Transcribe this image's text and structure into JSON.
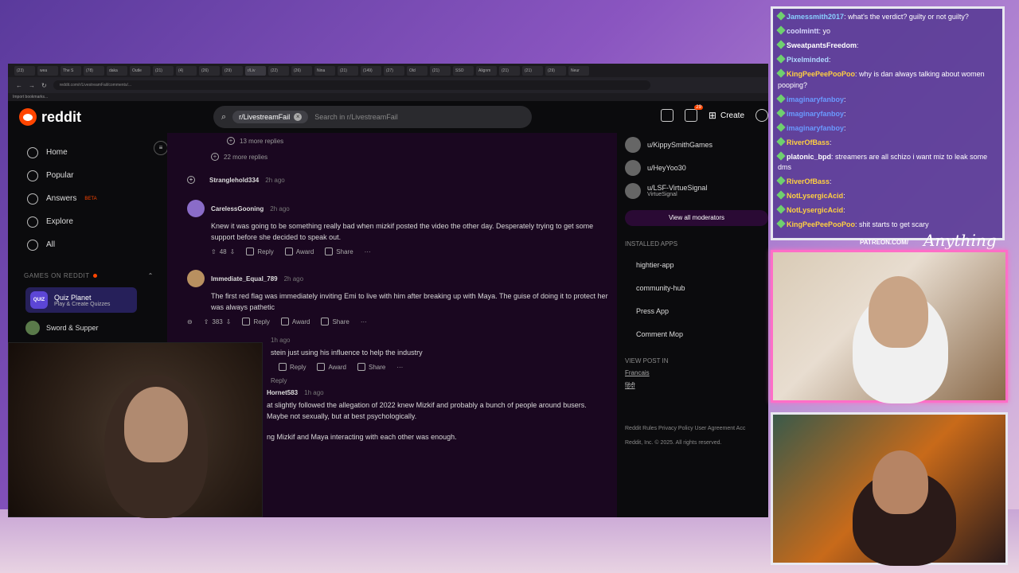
{
  "browser": {
    "tabs": [
      "(23)",
      "wea",
      "The S",
      "(78)",
      "daka",
      "Outle",
      "(21)",
      "(4)",
      "(26)",
      "(29)",
      "r/Liv",
      "(22)",
      "(26)",
      "Nina",
      "(21)",
      "(149)",
      "(27)",
      "Old",
      "(21)",
      "SSO",
      "Alignm",
      "(21)",
      "(21)",
      "(29)",
      "Neur"
    ],
    "url": "reddit.com/r/LivestreamFail/comments/...",
    "bookmarks_label": "Import bookmarks..."
  },
  "reddit": {
    "logo_text": "reddit",
    "search": {
      "chip": "r/LivestreamFail",
      "placeholder": "Search in r/LivestreamFail"
    },
    "chat_badge": "29",
    "create_label": "Create",
    "nav": [
      {
        "label": "Home",
        "icon": "home-icon"
      },
      {
        "label": "Popular",
        "icon": "popular-icon"
      },
      {
        "label": "Answers",
        "icon": "answers-icon",
        "badge": "BETA"
      },
      {
        "label": "Explore",
        "icon": "explore-icon"
      },
      {
        "label": "All",
        "icon": "all-icon"
      }
    ],
    "games_label": "GAMES ON REDDIT",
    "quiz": {
      "icon_text": "QUIZ",
      "title": "Quiz Planet",
      "subtitle": "Play & Create Quizzes"
    },
    "sword": "Sword & Supper",
    "more_replies_1": "13 more replies",
    "more_replies_2": "22 more replies",
    "comments": [
      {
        "user": "Stranglehold334",
        "time": "2h ago",
        "body": "",
        "votes": ""
      },
      {
        "user": "CarelessGooning",
        "time": "2h ago",
        "body": "Knew it was going to be something really bad when mizkif posted the video the other day. Desperately trying to get some support before she decided to speak out.",
        "votes": "48"
      },
      {
        "user": "Immediate_Equal_789",
        "time": "2h ago",
        "body": "The first red flag was immediately inviting Emi to live with him after breaking up with Maya. The guise of doing it to protect her was always pathetic",
        "votes": "383"
      },
      {
        "user": "",
        "time": "1h ago",
        "body": "stein just using his influence to help the industry",
        "votes": ""
      },
      {
        "user": "Hornet583",
        "time": "1h ago",
        "body": "at slightly followed the allegation of 2022 knew Mizkif and probably a bunch of people around busers. Maybe not sexually, but at best psychologically.",
        "votes": ""
      }
    ],
    "last_line": "ng Mizkif and Maya interacting with each other was enough.",
    "actions": {
      "reply": "Reply",
      "award": "Award",
      "share": "Share",
      "more": "···"
    },
    "reply_link": "Reply",
    "moderators": [
      {
        "name": "u/KippySmithGames",
        "sub": ""
      },
      {
        "name": "u/HeyYoo30",
        "sub": ""
      },
      {
        "name": "u/LSF-VirtueSignal",
        "sub": "VirtueSignal"
      }
    ],
    "view_all_mods": "View all moderators",
    "installed_apps_label": "INSTALLED APPS",
    "apps": [
      "hightier-app",
      "community-hub",
      "Press App",
      "Comment Mop"
    ],
    "view_post_in_label": "VIEW POST IN",
    "languages": [
      "Francais",
      "हिंदी"
    ],
    "footer_links": "Reddit Rules   Privacy Policy   User Agreement   Acc",
    "footer_copy": "Reddit, Inc. © 2025. All rights reserved."
  },
  "chat": [
    {
      "user": "Jamessmith2017",
      "msg": "what's the verdict? guilty or not guilty?",
      "color": "#8ad0ff"
    },
    {
      "user": "coolmintt",
      "msg": "yo",
      "color": "#d8d8ff"
    },
    {
      "user": "SweatpantsFreedom",
      "msg": "",
      "color": "#ffffff"
    },
    {
      "user": "Pixelminded",
      "msg": "",
      "color": "#b0d8ff"
    },
    {
      "user": "KingPeePeePooPoo",
      "msg": "why is dan always talking about women pooping?",
      "color": "#ffd040"
    },
    {
      "user": "imaginaryfanboy",
      "msg": "",
      "color": "#6a9aff"
    },
    {
      "user": "imaginaryfanboy",
      "msg": "",
      "color": "#6a9aff"
    },
    {
      "user": "imaginaryfanboy",
      "msg": "",
      "color": "#6a9aff"
    },
    {
      "user": "RiverOfBass",
      "msg": "",
      "color": "#ffd040"
    },
    {
      "user": "platonic_bpd",
      "msg": "streamers are all schizo i want miz to leak some dms",
      "color": "#ffffff"
    },
    {
      "user": "RiverOfBass",
      "msg": "",
      "color": "#ffd040"
    },
    {
      "user": "NotLysergicAcid",
      "msg": "",
      "color": "#ffd040"
    },
    {
      "user": "NotLysergicAcid",
      "msg": "",
      "color": "#ffd040"
    },
    {
      "user": "KingPeePeePooPoo",
      "msg": "shit starts to get scary",
      "color": "#ffd040"
    }
  ],
  "overlay": {
    "patreon": "PATREON.COM/",
    "brand": "Anything Else"
  }
}
